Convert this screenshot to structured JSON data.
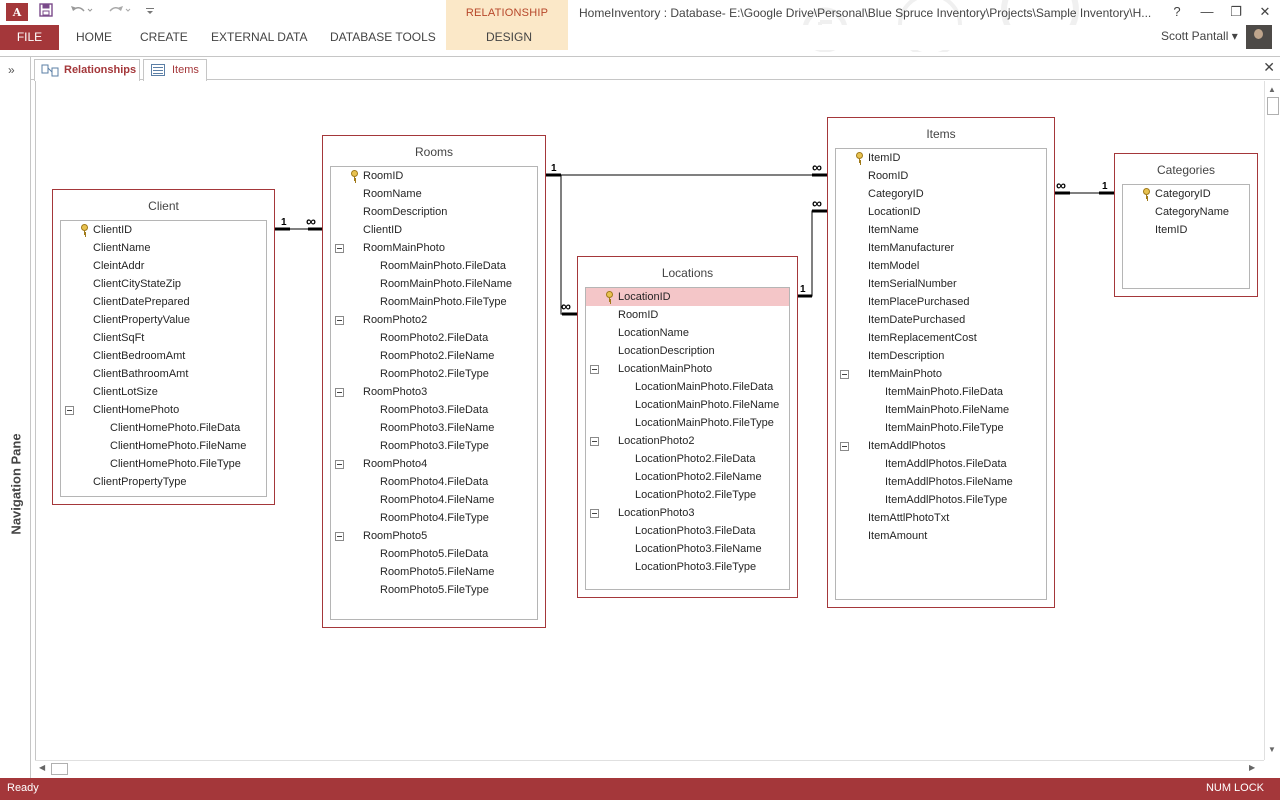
{
  "window": {
    "app_icon_text": "A",
    "title": "HomeInventory : Database- E:\\Google Drive\\Personal\\Blue Spruce Inventory\\Projects\\Sample Inventory\\H...",
    "help": "?",
    "minimize": "—",
    "restore": "❐",
    "close": "✕"
  },
  "ribbon": {
    "file": "FILE",
    "tabs": [
      "HOME",
      "CREATE",
      "EXTERNAL DATA",
      "DATABASE TOOLS"
    ],
    "contextual_group": "RELATIONSHIP TOOLS",
    "contextual_tab": "DESIGN",
    "user": "Scott Pantall ▾"
  },
  "nav_pane": {
    "label": "Navigation Pane",
    "toggle": "»"
  },
  "doc_tabs": [
    {
      "label": "Relationships",
      "active": true
    },
    {
      "label": "Items",
      "active": false
    }
  ],
  "close_doc": "✕",
  "tables": {
    "client": {
      "title": "Client",
      "fields": [
        {
          "name": "ClientID",
          "key": true
        },
        {
          "name": "ClientName"
        },
        {
          "name": "CleintAddr"
        },
        {
          "name": "ClientCityStateZip"
        },
        {
          "name": "ClientDatePrepared"
        },
        {
          "name": "ClientPropertyValue"
        },
        {
          "name": "ClientSqFt"
        },
        {
          "name": "ClientBedroomAmt"
        },
        {
          "name": "ClientBathroomAmt"
        },
        {
          "name": "ClientLotSize"
        },
        {
          "name": "ClientHomePhoto",
          "group": true
        },
        {
          "name": "ClientHomePhoto.FileData",
          "sub": true
        },
        {
          "name": "ClientHomePhoto.FileName",
          "sub": true
        },
        {
          "name": "ClientHomePhoto.FileType",
          "sub": true
        },
        {
          "name": "ClientPropertyType"
        }
      ]
    },
    "rooms": {
      "title": "Rooms",
      "fields": [
        {
          "name": "RoomID",
          "key": true
        },
        {
          "name": "RoomName"
        },
        {
          "name": "RoomDescription"
        },
        {
          "name": "ClientID"
        },
        {
          "name": "RoomMainPhoto",
          "group": true
        },
        {
          "name": "RoomMainPhoto.FileData",
          "sub": true
        },
        {
          "name": "RoomMainPhoto.FileName",
          "sub": true
        },
        {
          "name": "RoomMainPhoto.FileType",
          "sub": true
        },
        {
          "name": "RoomPhoto2",
          "group": true
        },
        {
          "name": "RoomPhoto2.FileData",
          "sub": true
        },
        {
          "name": "RoomPhoto2.FileName",
          "sub": true
        },
        {
          "name": "RoomPhoto2.FileType",
          "sub": true
        },
        {
          "name": "RoomPhoto3",
          "group": true
        },
        {
          "name": "RoomPhoto3.FileData",
          "sub": true
        },
        {
          "name": "RoomPhoto3.FileName",
          "sub": true
        },
        {
          "name": "RoomPhoto3.FileType",
          "sub": true
        },
        {
          "name": "RoomPhoto4",
          "group": true
        },
        {
          "name": "RoomPhoto4.FileData",
          "sub": true
        },
        {
          "name": "RoomPhoto4.FileName",
          "sub": true
        },
        {
          "name": "RoomPhoto4.FileType",
          "sub": true
        },
        {
          "name": "RoomPhoto5",
          "group": true
        },
        {
          "name": "RoomPhoto5.FileData",
          "sub": true
        },
        {
          "name": "RoomPhoto5.FileName",
          "sub": true
        },
        {
          "name": "RoomPhoto5.FileType",
          "sub": true
        }
      ]
    },
    "locations": {
      "title": "Locations",
      "fields": [
        {
          "name": "LocationID",
          "key": true,
          "selected": true
        },
        {
          "name": "RoomID"
        },
        {
          "name": "LocationName"
        },
        {
          "name": "LocationDescription"
        },
        {
          "name": "LocationMainPhoto",
          "group": true
        },
        {
          "name": "LocationMainPhoto.FileData",
          "sub": true
        },
        {
          "name": "LocationMainPhoto.FileName",
          "sub": true
        },
        {
          "name": "LocationMainPhoto.FileType",
          "sub": true
        },
        {
          "name": "LocationPhoto2",
          "group": true
        },
        {
          "name": "LocationPhoto2.FileData",
          "sub": true
        },
        {
          "name": "LocationPhoto2.FileName",
          "sub": true
        },
        {
          "name": "LocationPhoto2.FileType",
          "sub": true
        },
        {
          "name": "LocationPhoto3",
          "group": true
        },
        {
          "name": "LocationPhoto3.FileData",
          "sub": true
        },
        {
          "name": "LocationPhoto3.FileName",
          "sub": true
        },
        {
          "name": "LocationPhoto3.FileType",
          "sub": true
        }
      ]
    },
    "items": {
      "title": "Items",
      "fields": [
        {
          "name": "ItemID",
          "key": true
        },
        {
          "name": "RoomID"
        },
        {
          "name": "CategoryID"
        },
        {
          "name": "LocationID"
        },
        {
          "name": "ItemName"
        },
        {
          "name": "ItemManufacturer"
        },
        {
          "name": "ItemModel"
        },
        {
          "name": "ItemSerialNumber"
        },
        {
          "name": "ItemPlacePurchased"
        },
        {
          "name": "ItemDatePurchased"
        },
        {
          "name": "ItemReplacementCost"
        },
        {
          "name": "ItemDescription"
        },
        {
          "name": "ItemMainPhoto",
          "group": true
        },
        {
          "name": "ItemMainPhoto.FileData",
          "sub": true
        },
        {
          "name": "ItemMainPhoto.FileName",
          "sub": true
        },
        {
          "name": "ItemMainPhoto.FileType",
          "sub": true
        },
        {
          "name": "ItemAddlPhotos",
          "group": true
        },
        {
          "name": "ItemAddlPhotos.FileData",
          "sub": true
        },
        {
          "name": "ItemAddlPhotos.FileName",
          "sub": true
        },
        {
          "name": "ItemAddlPhotos.FileType",
          "sub": true
        },
        {
          "name": "ItemAttlPhotoTxt"
        },
        {
          "name": "ItemAmount"
        }
      ]
    },
    "categories": {
      "title": "Categories",
      "fields": [
        {
          "name": "CategoryID",
          "key": true
        },
        {
          "name": "CategoryName"
        },
        {
          "name": "ItemID"
        }
      ]
    }
  },
  "relationships": {
    "one_label": "1",
    "many_label": "∞"
  },
  "status": {
    "left": "Ready",
    "right": "NUM LOCK"
  }
}
